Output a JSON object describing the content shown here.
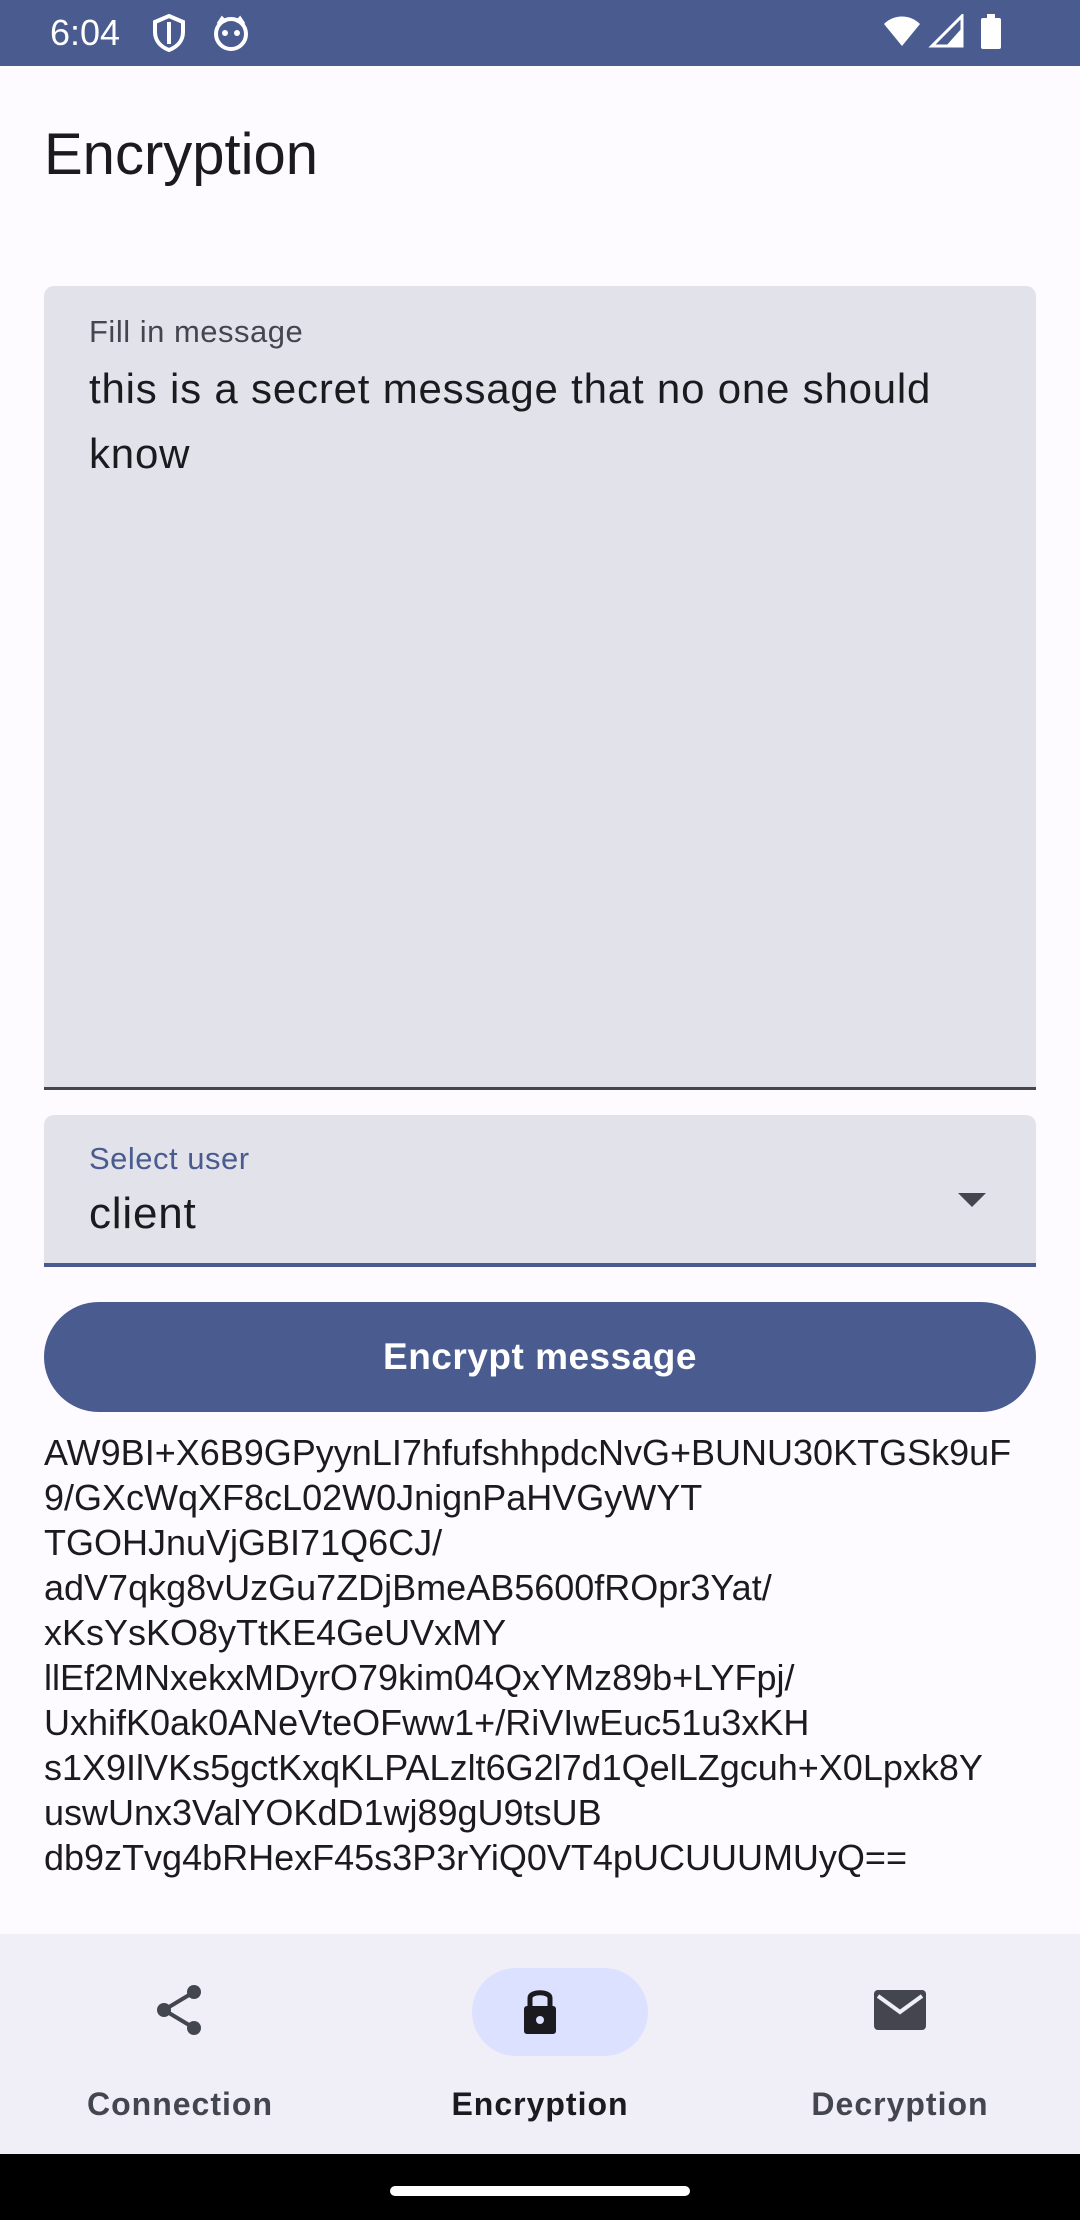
{
  "status_bar": {
    "time": "6:04",
    "icons": [
      "shield-icon",
      "cat-icon",
      "wifi-icon",
      "signal-icon",
      "battery-icon"
    ]
  },
  "page": {
    "title": "Encryption"
  },
  "message_field": {
    "label": "Fill in message",
    "value": "this is a secret message that no one should know"
  },
  "select_user": {
    "label": "Select user",
    "value": "client",
    "icon": "dropdown-arrow-icon"
  },
  "encrypt_button": {
    "label": "Encrypt message"
  },
  "cipher_output": {
    "lines": [
      "AW9BI+X6B9GPyynLI7hfufshhpdcNvG+BUNU30KTGSk9uF",
      "9/GXcWqXF8cL02W0JnignPaHVGyWYT",
      "TGOHJnuVjGBI71Q6CJ/",
      "adV7qkg8vUzGu7ZDjBmeAB5600fROpr3Yat/",
      "xKsYsKO8yTtKE4GeUVxMY",
      "llEf2MNxekxMDyrO79kim04QxYMz89b+LYFpj/",
      "UxhifK0ak0ANeVteOFww1+/RiVIwEuc51u3xKH",
      "s1X9IlVKs5gctKxqKLPALzlt6G2l7d1QelLZgcuh+X0Lpxk8Y",
      "uswUnx3ValYOKdD1wj89gU9tsUB",
      "db9zTvg4bRHexF45s3P3rYiQ0VT4pUCUUUMUyQ=="
    ]
  },
  "bottom_nav": {
    "items": [
      {
        "label": "Connection",
        "icon": "share-icon",
        "active": false
      },
      {
        "label": "Encryption",
        "icon": "lock-icon",
        "active": true
      },
      {
        "label": "Decryption",
        "icon": "mail-icon",
        "active": false
      }
    ]
  },
  "colors": {
    "primary": "#4a5b8f",
    "field_bg": "#e2e2ea",
    "nav_bg": "#f0eff7",
    "active_indicator": "#dce1ff"
  }
}
